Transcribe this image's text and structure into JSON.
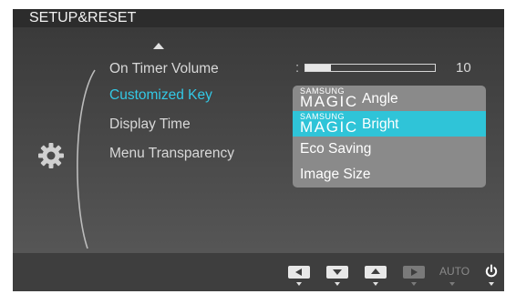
{
  "header": {
    "title": "SETUP&RESET"
  },
  "menu": {
    "items": [
      {
        "label": "On Timer  Volume"
      },
      {
        "label": "Customized Key"
      },
      {
        "label": "Display Time"
      },
      {
        "label": "Menu Transparency"
      }
    ],
    "active_index": 1
  },
  "volume": {
    "value": "10",
    "level_fraction": 0.2
  },
  "dropdown": {
    "options": [
      {
        "brand_top": "SAMSUNG",
        "brand_bottom": "MAGIC",
        "label": "Angle"
      },
      {
        "brand_top": "SAMSUNG",
        "brand_bottom": "MAGIC",
        "label": "Bright"
      },
      {
        "label": "Eco Saving"
      },
      {
        "label": "Image Size"
      }
    ],
    "selected_index": 1
  },
  "bottom_bar": {
    "buttons": [
      "left",
      "down",
      "up",
      "enter"
    ],
    "auto_label": "AUTO"
  },
  "colors": {
    "accent": "#33c9e6",
    "selection": "#2fc4d8",
    "panel": "#4a4a4a"
  },
  "icons": {
    "scroll_up": "up-arrow-icon",
    "category": "gear-icon",
    "power": "power-icon"
  }
}
